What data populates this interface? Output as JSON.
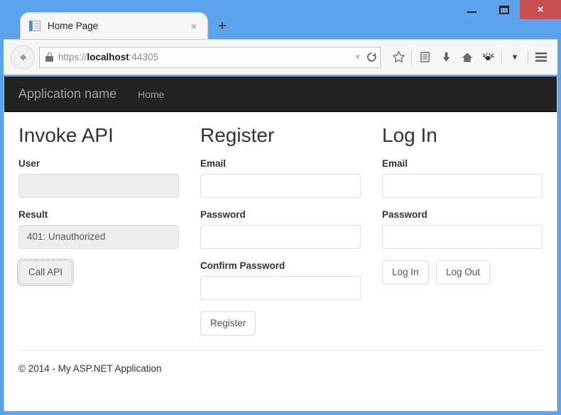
{
  "window": {
    "controls": {
      "minimize_label": "Minimize",
      "maximize_label": "Restore",
      "close_label": "×"
    }
  },
  "browser": {
    "tab": {
      "title": "Home Page",
      "close_label": "×",
      "favicon": "page-document-icon"
    },
    "new_tab_label": "+",
    "back_label": "←",
    "address_bar": {
      "scheme": "https://",
      "host": "localhost",
      "port": ":44305",
      "full_url": "https://localhost:44305",
      "lock_icon": "padlock-icon"
    },
    "url_actions": [
      {
        "name": "dropdown-arrow-icon",
        "glyph": "▾"
      },
      {
        "name": "reload-icon",
        "glyph": "↻"
      }
    ],
    "toolbar_icons": [
      {
        "name": "bookmark-star-icon",
        "glyph": "☆"
      },
      {
        "name": "reader-list-icon",
        "glyph": "▤"
      },
      {
        "name": "downloads-arrow-icon",
        "glyph": "⬇"
      },
      {
        "name": "home-icon",
        "glyph": "⌂"
      },
      {
        "name": "pocket-icon",
        "glyph": "✿"
      },
      {
        "name": "overflow-chevron-icon",
        "glyph": "▾"
      },
      {
        "name": "hamburger-menu-icon",
        "glyph": "≡"
      }
    ]
  },
  "page": {
    "navbar": {
      "brand": "Application name",
      "links": [
        {
          "label": "Home"
        }
      ]
    },
    "columns": [
      {
        "id": "invoke-api",
        "heading": "Invoke API",
        "fields": [
          {
            "id": "user",
            "label": "User",
            "value": "",
            "readonly": true
          },
          {
            "id": "result",
            "label": "Result",
            "value": "401: Unauthorized",
            "readonly": true
          }
        ],
        "buttons": [
          {
            "id": "call-api",
            "label": "Call API",
            "focused": true
          }
        ]
      },
      {
        "id": "register",
        "heading": "Register",
        "fields": [
          {
            "id": "register-email",
            "label": "Email",
            "value": "",
            "readonly": false
          },
          {
            "id": "register-password",
            "label": "Password",
            "value": "",
            "readonly": false
          },
          {
            "id": "register-confirm-password",
            "label": "Confirm Password",
            "value": "",
            "readonly": false
          }
        ],
        "buttons": [
          {
            "id": "register",
            "label": "Register",
            "focused": false
          }
        ]
      },
      {
        "id": "log-in",
        "heading": "Log In",
        "fields": [
          {
            "id": "login-email",
            "label": "Email",
            "value": "",
            "readonly": false
          },
          {
            "id": "login-password",
            "label": "Password",
            "value": "",
            "readonly": false
          }
        ],
        "buttons": [
          {
            "id": "log-in",
            "label": "Log In",
            "focused": false
          },
          {
            "id": "log-out",
            "label": "Log Out",
            "focused": false
          }
        ]
      }
    ],
    "footer": {
      "text": "© 2014 - My ASP.NET Application"
    }
  },
  "colors": {
    "window_frame": "#5ba4ec",
    "close_button": "#c75050",
    "navbar_bg": "#222222",
    "navbar_text": "#9d9d9d",
    "readonly_field_bg": "#eeeeee",
    "body_text": "#333333"
  }
}
